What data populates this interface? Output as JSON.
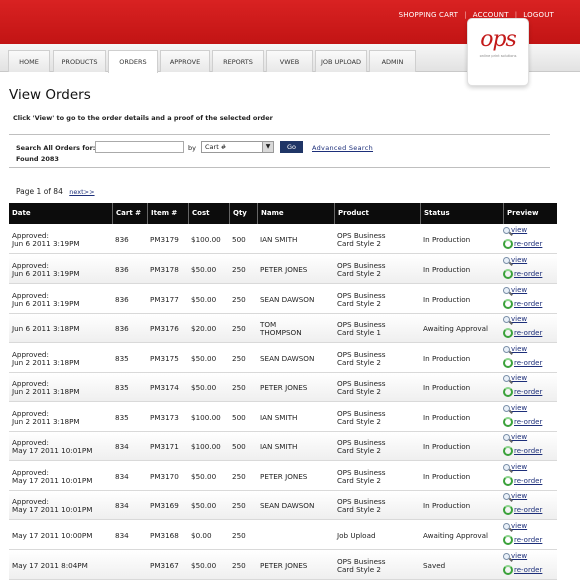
{
  "header": {
    "links": [
      "SHOPPING CART",
      "ACCOUNT",
      "LOGOUT"
    ],
    "logo_text": "ops",
    "logo_tagline": "online print solutions"
  },
  "nav": {
    "tabs": [
      "HOME",
      "PRODUCTS",
      "ORDERS",
      "APPROVE",
      "REPORTS",
      "VWEB",
      "JOB UPLOAD",
      "ADMIN"
    ],
    "active": "ORDERS"
  },
  "page": {
    "title": "View Orders",
    "hint": "Click 'View' to go to the order details and a proof of the selected order"
  },
  "search": {
    "label": "Search All Orders for:",
    "input_value": "",
    "by_label": "by",
    "select_value": "Cart #",
    "go_label": "Go",
    "advanced_label": "Advanced Search",
    "found_text": "Found 2083"
  },
  "pager": {
    "text": "Page 1 of 84",
    "next_label": "next>>"
  },
  "table": {
    "headers": [
      "Date",
      "Cart #",
      "Item #",
      "Cost",
      "Qty",
      "Name",
      "Product",
      "Status",
      "Preview"
    ],
    "view_label": "view",
    "reorder_label": "re-order",
    "rows": [
      {
        "date1": "Approved:",
        "date2": "Jun 6 2011 3:19PM",
        "cart": "836",
        "item": "PM3179",
        "cost": "$100.00",
        "qty": "500",
        "name1": "IAN SMITH",
        "name2": "",
        "prod1": "OPS Business",
        "prod2": "Card Style 2",
        "status": "In Production"
      },
      {
        "date1": "Approved:",
        "date2": "Jun 6 2011 3:19PM",
        "cart": "836",
        "item": "PM3178",
        "cost": "$50.00",
        "qty": "250",
        "name1": "PETER JONES",
        "name2": "",
        "prod1": "OPS Business",
        "prod2": "Card Style 2",
        "status": "In Production"
      },
      {
        "date1": "Approved:",
        "date2": "Jun 6 2011 3:19PM",
        "cart": "836",
        "item": "PM3177",
        "cost": "$50.00",
        "qty": "250",
        "name1": "SEAN DAWSON",
        "name2": "",
        "prod1": "OPS Business",
        "prod2": "Card Style 2",
        "status": "In Production"
      },
      {
        "date1": "Jun 6 2011 3:18PM",
        "date2": "",
        "cart": "836",
        "item": "PM3176",
        "cost": "$20.00",
        "qty": "250",
        "name1": "TOM",
        "name2": "THOMPSON",
        "prod1": "OPS Business",
        "prod2": "Card Style 1",
        "status": "Awaiting Approval"
      },
      {
        "date1": "Approved:",
        "date2": "Jun 2 2011 3:18PM",
        "cart": "835",
        "item": "PM3175",
        "cost": "$50.00",
        "qty": "250",
        "name1": "SEAN DAWSON",
        "name2": "",
        "prod1": "OPS Business",
        "prod2": "Card Style 2",
        "status": "In Production"
      },
      {
        "date1": "Approved:",
        "date2": "Jun 2 2011 3:18PM",
        "cart": "835",
        "item": "PM3174",
        "cost": "$50.00",
        "qty": "250",
        "name1": "PETER JONES",
        "name2": "",
        "prod1": "OPS Business",
        "prod2": "Card Style 2",
        "status": "In Production"
      },
      {
        "date1": "Approved:",
        "date2": "Jun 2 2011 3:18PM",
        "cart": "835",
        "item": "PM3173",
        "cost": "$100.00",
        "qty": "500",
        "name1": "IAN SMITH",
        "name2": "",
        "prod1": "OPS Business",
        "prod2": "Card Style 2",
        "status": "In Production"
      },
      {
        "date1": "Approved:",
        "date2": "May 17 2011 10:01PM",
        "cart": "834",
        "item": "PM3171",
        "cost": "$100.00",
        "qty": "500",
        "name1": "IAN SMITH",
        "name2": "",
        "prod1": "OPS Business",
        "prod2": "Card Style 2",
        "status": "In Production"
      },
      {
        "date1": "Approved:",
        "date2": "May 17 2011 10:01PM",
        "cart": "834",
        "item": "PM3170",
        "cost": "$50.00",
        "qty": "250",
        "name1": "PETER JONES",
        "name2": "",
        "prod1": "OPS Business",
        "prod2": "Card Style 2",
        "status": "In Production"
      },
      {
        "date1": "Approved:",
        "date2": "May 17 2011 10:01PM",
        "cart": "834",
        "item": "PM3169",
        "cost": "$50.00",
        "qty": "250",
        "name1": "SEAN DAWSON",
        "name2": "",
        "prod1": "OPS Business",
        "prod2": "Card Style 2",
        "status": "In Production"
      },
      {
        "date1": "May 17 2011 10:00PM",
        "date2": "",
        "cart": "834",
        "item": "PM3168",
        "cost": "$0.00",
        "qty": "250",
        "name1": "",
        "name2": "",
        "prod1": "Job Upload",
        "prod2": "",
        "status": "Awaiting Approval"
      },
      {
        "date1": "May 17 2011 8:04PM",
        "date2": "",
        "cart": "",
        "item": "PM3167",
        "cost": "$50.00",
        "qty": "250",
        "name1": "PETER JONES",
        "name2": "",
        "prod1": "OPS Business",
        "prod2": "Card Style 2",
        "status": "Saved"
      }
    ]
  },
  "colors": {
    "brand_red": "#c91a1a",
    "header_black": "#0c0c0c",
    "link_blue": "#1d2f7a",
    "go_button": "#1f3566"
  }
}
